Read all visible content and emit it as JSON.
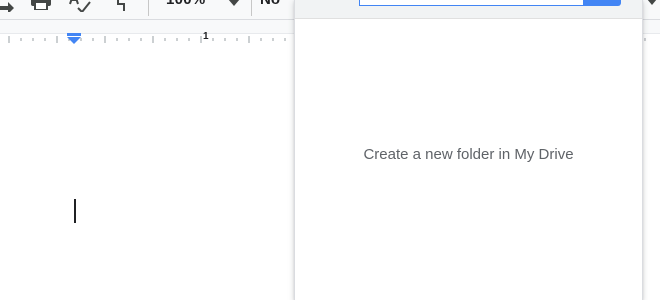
{
  "toolbar": {
    "zoom_value": "100%",
    "style_value": "No",
    "icons": [
      "redo-icon",
      "print-icon",
      "spellcheck-icon",
      "paint-format-icon",
      "chevron-down-icon"
    ]
  },
  "ruler": {
    "inch_label": "1",
    "indent_color": "#4285f4"
  },
  "folder_dialog": {
    "name_input_value": "",
    "empty_message": "Create a new folder in My Drive",
    "accent_color": "#4285f4"
  }
}
